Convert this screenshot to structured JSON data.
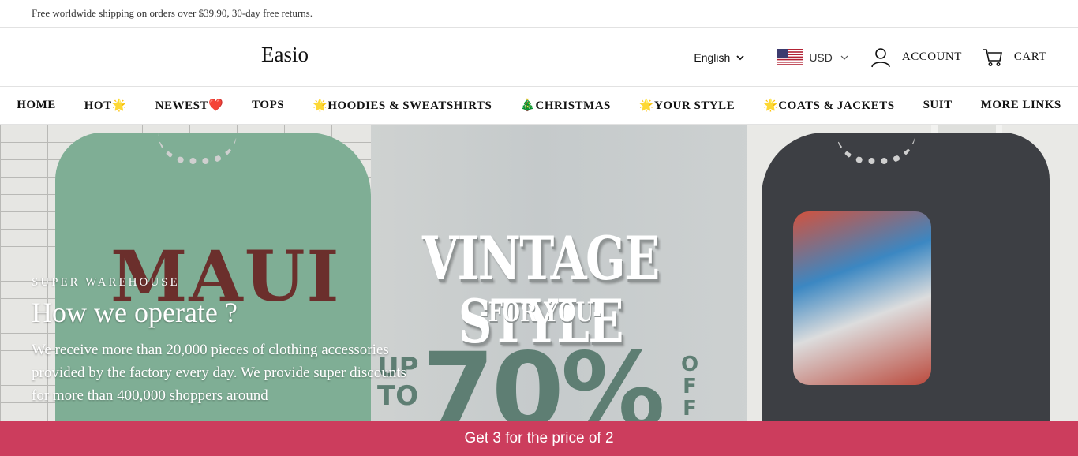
{
  "announcement": "Free worldwide shipping on orders over $39.90, 30-day free returns.",
  "header": {
    "logo": "Easio",
    "language": "English",
    "currency": "USD",
    "account_label": "ACCOUNT",
    "cart_label": "CART"
  },
  "nav": {
    "items": [
      "HOME",
      "HOT🌟",
      "NEWEST❤️",
      "TOPS",
      "🌟HOODIES & SWEATSHIRTS",
      "🎄CHRISTMAS",
      "🌟YOUR STYLE",
      "🌟COATS & JACKETS",
      "SUIT",
      "MORE LINKS"
    ]
  },
  "hero": {
    "banner_headline": "VINTAGE STYLE",
    "banner_sub": "-FOR YOU-",
    "banner_upto_1": "UP",
    "banner_upto_2": "TO",
    "banner_percent": "70%",
    "banner_off": "OFF",
    "shirt_print": "MAUI",
    "eyebrow": "SUPER WAREHOUSE",
    "title": "How we operate ?",
    "body": "We receive more than 20,000 pieces of clothing accessories provided by the factory every day. We provide super discounts for more than 400,000 shoppers around"
  },
  "promo_bar": "Get 3 for the price of 2",
  "colors": {
    "promo": "#cc3d5d",
    "banner_text": "#5e7e73"
  }
}
